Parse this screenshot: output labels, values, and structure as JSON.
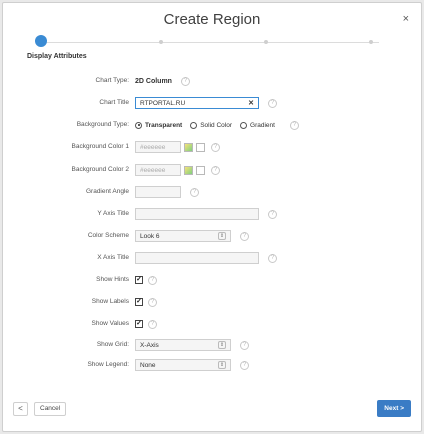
{
  "dialog": {
    "title": "Create Region",
    "close_label": "×"
  },
  "wizard": {
    "steps": [
      "Display Attributes",
      "",
      "",
      ""
    ],
    "current_step_label": "Display Attributes"
  },
  "form": {
    "chart_type": {
      "label": "Chart Type:",
      "value": "2D Column"
    },
    "chart_title": {
      "label": "Chart Title",
      "value": "RTPORTAL.RU"
    },
    "background_type": {
      "label": "Background Type:",
      "options": [
        "Transparent",
        "Solid Color",
        "Gradient"
      ],
      "selected": "Transparent"
    },
    "background_color_1": {
      "label": "Background Color 1",
      "placeholder": "#eeeeee"
    },
    "background_color_2": {
      "label": "Background Color 2",
      "placeholder": "#eeeeee"
    },
    "gradient_angle": {
      "label": "Gradient Angle",
      "value": ""
    },
    "y_axis_title": {
      "label": "Y Axis Title",
      "value": ""
    },
    "color_scheme": {
      "label": "Color Scheme",
      "value": "Look 6"
    },
    "x_axis_title": {
      "label": "X Axis Title",
      "value": ""
    },
    "show_hints": {
      "label": "Show Hints",
      "checked": true
    },
    "show_labels": {
      "label": "Show Labels",
      "checked": true
    },
    "show_values": {
      "label": "Show Values",
      "checked": true
    },
    "show_grid": {
      "label": "Show Grid:",
      "value": "X-Axis"
    },
    "show_legend": {
      "label": "Show Legend:",
      "value": "None"
    }
  },
  "footer": {
    "back_label": "<",
    "cancel_label": "Cancel",
    "next_label": "Next >"
  },
  "colors": {
    "accent": "#3a8bd4",
    "next_button": "#3a7cc5"
  }
}
